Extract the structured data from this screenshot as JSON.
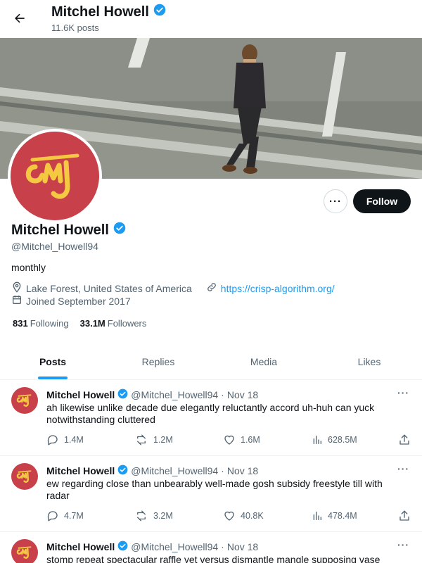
{
  "header": {
    "name": "Mitchel Howell",
    "posts_count": "11.6K posts"
  },
  "profile": {
    "name": "Mitchel Howell",
    "handle": "@Mitchel_Howell94",
    "bio": "monthly",
    "location": "Lake Forest, United States of America",
    "website": "https://crisp-algorithm.org/",
    "joined": "Joined September 2017",
    "following_count": "831",
    "following_label": "Following",
    "followers_count": "33.1M",
    "followers_label": "Followers",
    "follow_button": "Follow",
    "more_button": "···"
  },
  "tabs": [
    {
      "label": "Posts",
      "active": true
    },
    {
      "label": "Replies",
      "active": false
    },
    {
      "label": "Media",
      "active": false
    },
    {
      "label": "Likes",
      "active": false
    }
  ],
  "posts": [
    {
      "name": "Mitchel Howell",
      "handle": "@Mitchel_Howell94",
      "sep": "·",
      "date": "Nov 18",
      "text": "ah likewise unlike decade due elegantly reluctantly accord uh-huh can yuck notwithstanding cluttered",
      "replies": "1.4M",
      "reposts": "1.2M",
      "likes": "1.6M",
      "views": "628.5M"
    },
    {
      "name": "Mitchel Howell",
      "handle": "@Mitchel_Howell94",
      "sep": "·",
      "date": "Nov 18",
      "text": "ew regarding close than unbearably well-made gosh subsidy freestyle till with radar",
      "replies": "4.7M",
      "reposts": "3.2M",
      "likes": "40.8K",
      "views": "478.4M"
    },
    {
      "name": "Mitchel Howell",
      "handle": "@Mitchel_Howell94",
      "sep": "·",
      "date": "Nov 18",
      "text": "stomp repeat spectacular raffle yet versus dismantle mangle supposing vase",
      "replies": "",
      "reposts": "",
      "likes": "",
      "views": ""
    }
  ],
  "logo_text": "cmj",
  "colors": {
    "accent": "#1d9bf0",
    "avatar_bg": "#c8404a",
    "logo_fg": "#f5c842"
  }
}
